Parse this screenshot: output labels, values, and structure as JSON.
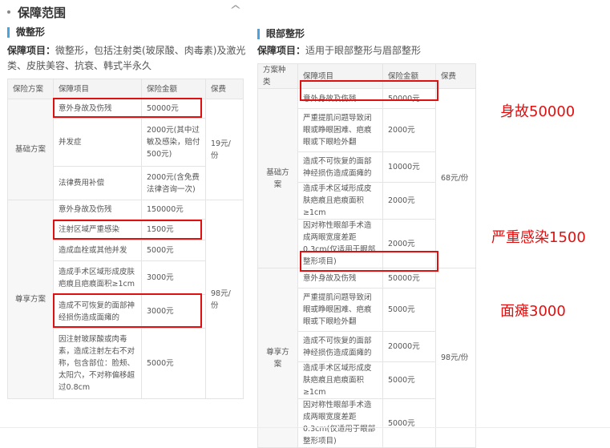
{
  "header": {
    "title": "保障范围"
  },
  "left": {
    "section_title": "微整形",
    "desc_label": "保障项目：",
    "desc_text": "微整形，包括注射类(玻尿酸、肉毒素)及激光类、皮肤美容、抗衰、韩式半永久",
    "columns": [
      "保险方案",
      "保障项目",
      "保险金额",
      "保费"
    ],
    "basic": {
      "plan": "基础方案",
      "fee": "19元/份",
      "rows": [
        [
          "意外身故及伤残",
          "50000元"
        ],
        [
          "并发症",
          "2000元(其中过敏及感染，赔付500元)"
        ],
        [
          "法律费用补偿",
          "2000元(含免费法律咨询一次)"
        ]
      ]
    },
    "premium": {
      "plan": "尊享方案",
      "fee": "98元/份",
      "rows": [
        [
          "意外身故及伤残",
          "150000元"
        ],
        [
          "注射区域严重感染",
          "1500元"
        ],
        [
          "造成血栓或其他并发",
          "5000元"
        ],
        [
          "造成手术区域形成皮肤疤痕且疤痕面积≥1cm",
          "3000元"
        ],
        [
          "造成不可恢复的面部神经损伤造成面瘫的",
          "3000元"
        ],
        [
          "因注射玻尿酸或肉毒素，造成注射左右不对称，包含部位：脸颊、太阳穴，不对称偏移超过0.8cm",
          "5000元"
        ]
      ]
    }
  },
  "right": {
    "section_title": "眼部整形",
    "desc_label": "保障项目：",
    "desc_text": "适用于眼部整形与眉部整形",
    "columns": [
      "方案种类",
      "保障项目",
      "保险金额",
      "保费"
    ],
    "basic": {
      "plan": "基础方案",
      "fee": "68元/份",
      "rows": [
        [
          "意外身故及伤残",
          "50000元"
        ],
        [
          "严重提肌问题导致闭眼或睁眼困难、疤痕眼或下眼睑外翻",
          "2000元"
        ],
        [
          "造成不可恢复的面部神经损伤造成面瘫的",
          "10000元"
        ],
        [
          "造成手术区域形成皮肤疤痕且疤痕面积≥1cm",
          "2000元"
        ],
        [
          "因对称性眼部手术造成两眼宽度差距0.3cm(仅适用于眼部整形项目)",
          "2000元"
        ]
      ]
    },
    "premium": {
      "plan": "尊享方案",
      "fee": "98元/份",
      "rows": [
        [
          "意外身故及伤残",
          "50000元"
        ],
        [
          "严重提肌问题导致闭眼或睁眼困难、疤痕眼或下眼睑外翻",
          "5000元"
        ],
        [
          "造成不可恢复的面部神经损伤造成面瘫的",
          "20000元"
        ],
        [
          "造成手术区域形成皮肤疤痕且疤痕面积≥1cm",
          "5000元"
        ],
        [
          "因对称性眼部手术造成两眼宽度差距0.3cm(仅适用于眼部整形项目)",
          "5000元"
        ]
      ]
    }
  },
  "annotations": [
    "身故50000",
    "严重感染1500",
    "面瘫3000"
  ],
  "colors": {
    "highlight": "#e01010",
    "accent": "#4aa3df"
  }
}
